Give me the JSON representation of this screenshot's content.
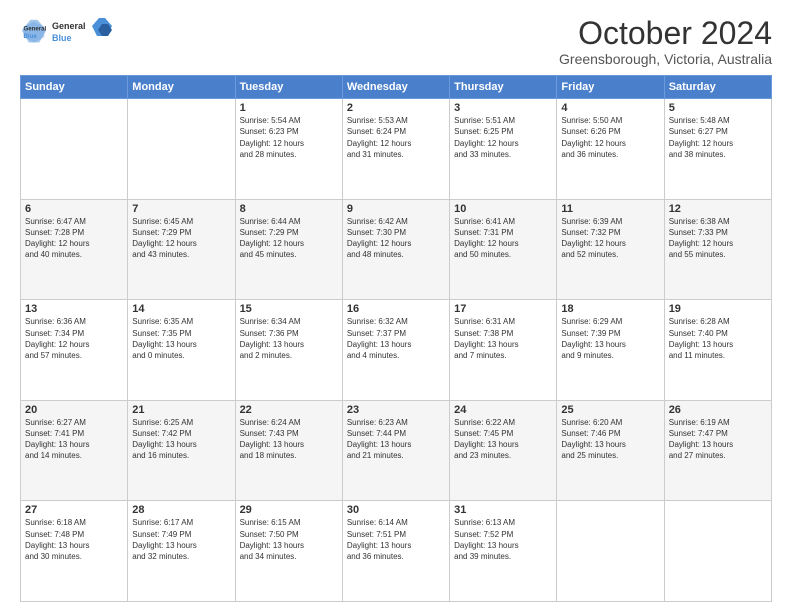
{
  "logo": {
    "line1": "General",
    "line2": "Blue"
  },
  "title": "October 2024",
  "subtitle": "Greensborough, Victoria, Australia",
  "weekdays": [
    "Sunday",
    "Monday",
    "Tuesday",
    "Wednesday",
    "Thursday",
    "Friday",
    "Saturday"
  ],
  "weeks": [
    [
      {
        "day": "",
        "info": ""
      },
      {
        "day": "",
        "info": ""
      },
      {
        "day": "1",
        "info": "Sunrise: 5:54 AM\nSunset: 6:23 PM\nDaylight: 12 hours\nand 28 minutes."
      },
      {
        "day": "2",
        "info": "Sunrise: 5:53 AM\nSunset: 6:24 PM\nDaylight: 12 hours\nand 31 minutes."
      },
      {
        "day": "3",
        "info": "Sunrise: 5:51 AM\nSunset: 6:25 PM\nDaylight: 12 hours\nand 33 minutes."
      },
      {
        "day": "4",
        "info": "Sunrise: 5:50 AM\nSunset: 6:26 PM\nDaylight: 12 hours\nand 36 minutes."
      },
      {
        "day": "5",
        "info": "Sunrise: 5:48 AM\nSunset: 6:27 PM\nDaylight: 12 hours\nand 38 minutes."
      }
    ],
    [
      {
        "day": "6",
        "info": "Sunrise: 6:47 AM\nSunset: 7:28 PM\nDaylight: 12 hours\nand 40 minutes."
      },
      {
        "day": "7",
        "info": "Sunrise: 6:45 AM\nSunset: 7:29 PM\nDaylight: 12 hours\nand 43 minutes."
      },
      {
        "day": "8",
        "info": "Sunrise: 6:44 AM\nSunset: 7:29 PM\nDaylight: 12 hours\nand 45 minutes."
      },
      {
        "day": "9",
        "info": "Sunrise: 6:42 AM\nSunset: 7:30 PM\nDaylight: 12 hours\nand 48 minutes."
      },
      {
        "day": "10",
        "info": "Sunrise: 6:41 AM\nSunset: 7:31 PM\nDaylight: 12 hours\nand 50 minutes."
      },
      {
        "day": "11",
        "info": "Sunrise: 6:39 AM\nSunset: 7:32 PM\nDaylight: 12 hours\nand 52 minutes."
      },
      {
        "day": "12",
        "info": "Sunrise: 6:38 AM\nSunset: 7:33 PM\nDaylight: 12 hours\nand 55 minutes."
      }
    ],
    [
      {
        "day": "13",
        "info": "Sunrise: 6:36 AM\nSunset: 7:34 PM\nDaylight: 12 hours\nand 57 minutes."
      },
      {
        "day": "14",
        "info": "Sunrise: 6:35 AM\nSunset: 7:35 PM\nDaylight: 13 hours\nand 0 minutes."
      },
      {
        "day": "15",
        "info": "Sunrise: 6:34 AM\nSunset: 7:36 PM\nDaylight: 13 hours\nand 2 minutes."
      },
      {
        "day": "16",
        "info": "Sunrise: 6:32 AM\nSunset: 7:37 PM\nDaylight: 13 hours\nand 4 minutes."
      },
      {
        "day": "17",
        "info": "Sunrise: 6:31 AM\nSunset: 7:38 PM\nDaylight: 13 hours\nand 7 minutes."
      },
      {
        "day": "18",
        "info": "Sunrise: 6:29 AM\nSunset: 7:39 PM\nDaylight: 13 hours\nand 9 minutes."
      },
      {
        "day": "19",
        "info": "Sunrise: 6:28 AM\nSunset: 7:40 PM\nDaylight: 13 hours\nand 11 minutes."
      }
    ],
    [
      {
        "day": "20",
        "info": "Sunrise: 6:27 AM\nSunset: 7:41 PM\nDaylight: 13 hours\nand 14 minutes."
      },
      {
        "day": "21",
        "info": "Sunrise: 6:25 AM\nSunset: 7:42 PM\nDaylight: 13 hours\nand 16 minutes."
      },
      {
        "day": "22",
        "info": "Sunrise: 6:24 AM\nSunset: 7:43 PM\nDaylight: 13 hours\nand 18 minutes."
      },
      {
        "day": "23",
        "info": "Sunrise: 6:23 AM\nSunset: 7:44 PM\nDaylight: 13 hours\nand 21 minutes."
      },
      {
        "day": "24",
        "info": "Sunrise: 6:22 AM\nSunset: 7:45 PM\nDaylight: 13 hours\nand 23 minutes."
      },
      {
        "day": "25",
        "info": "Sunrise: 6:20 AM\nSunset: 7:46 PM\nDaylight: 13 hours\nand 25 minutes."
      },
      {
        "day": "26",
        "info": "Sunrise: 6:19 AM\nSunset: 7:47 PM\nDaylight: 13 hours\nand 27 minutes."
      }
    ],
    [
      {
        "day": "27",
        "info": "Sunrise: 6:18 AM\nSunset: 7:48 PM\nDaylight: 13 hours\nand 30 minutes."
      },
      {
        "day": "28",
        "info": "Sunrise: 6:17 AM\nSunset: 7:49 PM\nDaylight: 13 hours\nand 32 minutes."
      },
      {
        "day": "29",
        "info": "Sunrise: 6:15 AM\nSunset: 7:50 PM\nDaylight: 13 hours\nand 34 minutes."
      },
      {
        "day": "30",
        "info": "Sunrise: 6:14 AM\nSunset: 7:51 PM\nDaylight: 13 hours\nand 36 minutes."
      },
      {
        "day": "31",
        "info": "Sunrise: 6:13 AM\nSunset: 7:52 PM\nDaylight: 13 hours\nand 39 minutes."
      },
      {
        "day": "",
        "info": ""
      },
      {
        "day": "",
        "info": ""
      }
    ]
  ]
}
